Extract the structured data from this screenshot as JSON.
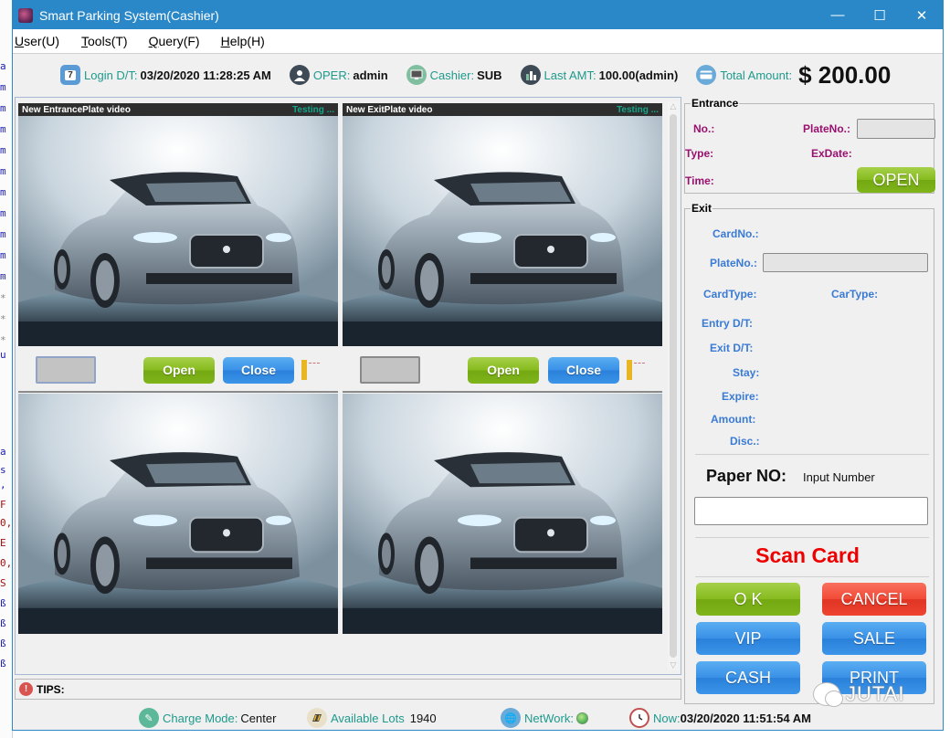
{
  "background_strip": {
    "chars": [
      "a",
      "m",
      "m",
      "m",
      "m",
      "m",
      "m",
      "m",
      "m",
      "m",
      "m",
      "*",
      "*",
      "*",
      "*",
      "u",
      "a",
      "s",
      ",",
      "F",
      "0,",
      "E",
      "0,",
      "S",
      "ß",
      "ß",
      "ß",
      "ß"
    ]
  },
  "window": {
    "title": "Smart Parking System(Cashier)",
    "controls": {
      "minimize": "—",
      "maximize": "☐",
      "close": "✕"
    }
  },
  "menu": [
    {
      "label": "User(U)",
      "mnemonic": "U"
    },
    {
      "label": "Tools(T)",
      "mnemonic": "T"
    },
    {
      "label": "Query(F)",
      "mnemonic": "F"
    },
    {
      "label": "Help(H)",
      "mnemonic": "H"
    }
  ],
  "infobar": {
    "login_label": "Login D/T:",
    "login_value": "03/20/2020 11:28:25 AM",
    "login_icon_text": "7",
    "oper_label": "OPER:",
    "oper_value": "admin",
    "cashier_label": "Cashier:",
    "cashier_value": "SUB",
    "last_amt_label": "Last AMT:",
    "last_amt_value": "100.00(admin)",
    "total_label": "Total Amount:",
    "total_value": "$ 200.00"
  },
  "cameras": {
    "entrance": {
      "title": "New EntrancePlate video",
      "status": "Testing ..."
    },
    "exit": {
      "title": "New ExitPlate video",
      "status": "Testing ..."
    }
  },
  "camera_controls": {
    "open_label": "Open",
    "close_label": "Close"
  },
  "tips": {
    "label": "TIPS:",
    "icon": "!"
  },
  "entrance": {
    "legend": "Entrance",
    "no_label": "No.:",
    "plateno_label": "PlateNo.:",
    "type_label": "Type:",
    "exdate_label": "ExDate:",
    "time_label": "Time:",
    "open_button": "OPEN"
  },
  "exit": {
    "legend": "Exit",
    "cardno_label": "CardNo.:",
    "plateno_label": "PlateNo.:",
    "cardtype_label": "CardType:",
    "cartype_label": "CarType:",
    "entry_dt_label": "Entry D/T:",
    "exit_dt_label": "Exit D/T:",
    "stay_label": "Stay:",
    "expire_label": "Expire:",
    "amount_label": "Amount:",
    "disc_label": "Disc.:"
  },
  "paper": {
    "label": "Paper NO:",
    "hint": "Input Number",
    "value": ""
  },
  "scan_card": "Scan Card",
  "actions": {
    "ok": "O K",
    "cancel": "CANCEL",
    "vip": "VIP",
    "sale": "SALE",
    "cash": "CASH",
    "print": "PRINT"
  },
  "statusbar": {
    "charge_mode_label": "Charge Mode:",
    "charge_mode_value": "Center",
    "available_lots_label": "Available Lots",
    "available_lots_value": "1940",
    "network_label": "NetWork:",
    "now_label": "Now:",
    "now_value": "03/20/2020 11:51:54 AM"
  },
  "watermark": "JUTAI",
  "colors": {
    "titlebar": "#2b88c8",
    "label_teal": "#1e9a8c",
    "entrance_label": "#9a1070",
    "exit_label": "#3a7bd5",
    "scan_card": "#ee0000",
    "btn_green": "#86bb1e",
    "btn_blue": "#3990e6",
    "btn_red": "#f24a36",
    "network_ok": "#5cb85c"
  }
}
